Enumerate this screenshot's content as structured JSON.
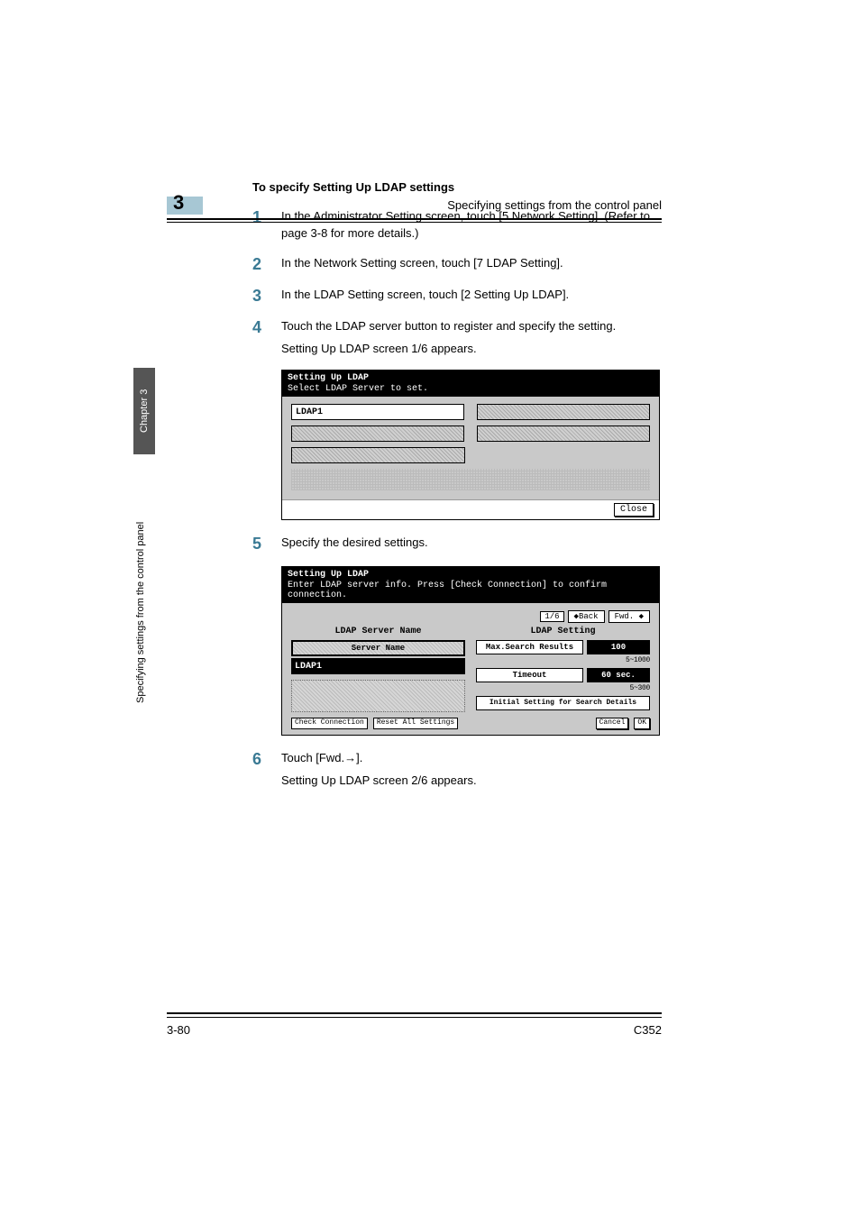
{
  "chapter_number": "3",
  "running_head_right": "Specifying settings from the control panel",
  "side_tab": "Chapter 3",
  "side_caption": "Specifying settings from the control panel",
  "section_title": "To specify Setting Up LDAP settings",
  "steps": {
    "s1": {
      "num": "1",
      "body": "In the Administrator Setting screen, touch [5 Network Setting]. (Refer to page 3-8 for more details.)"
    },
    "s2": {
      "num": "2",
      "body": "In the Network Setting screen, touch [7 LDAP Setting]."
    },
    "s3": {
      "num": "3",
      "body": "In the LDAP Setting screen, touch [2 Setting Up LDAP]."
    },
    "s4": {
      "num": "4",
      "body": "Touch the LDAP server button to register and specify the setting.",
      "sub": "Setting Up LDAP screen 1/6 appears."
    },
    "s5": {
      "num": "5",
      "body": "Specify the desired settings."
    },
    "s6": {
      "num": "6",
      "body": "Touch [Fwd.→].",
      "sub": "Setting Up LDAP screen 2/6 appears."
    }
  },
  "panel1": {
    "title": "Setting Up LDAP",
    "subtitle": "Select LDAP Server to set.",
    "slot1": "LDAP1",
    "close": "Close"
  },
  "panel2": {
    "title": "Setting Up LDAP",
    "subtitle": "Enter LDAP server info. Press [Check Connection] to confirm connection.",
    "page": "1/6",
    "back": "Back",
    "fwd": "Fwd.",
    "left_header": "LDAP Server Name",
    "server_name_btn": "Server Name",
    "server_value": "LDAP1",
    "right_header": "LDAP Setting",
    "max_label": "Max.Search Results",
    "max_value": "100",
    "max_hint": "5~1000",
    "timeout_label": "Timeout",
    "timeout_value": "60 sec.",
    "timeout_hint": "5~300",
    "initial_btn": "Initial Setting for Search Details",
    "check_btn": "Check Connection",
    "reset_btn": "Reset All Settings",
    "cancel": "Cancel",
    "ok": "OK"
  },
  "footer": {
    "left": "3-80",
    "right": "C352"
  }
}
